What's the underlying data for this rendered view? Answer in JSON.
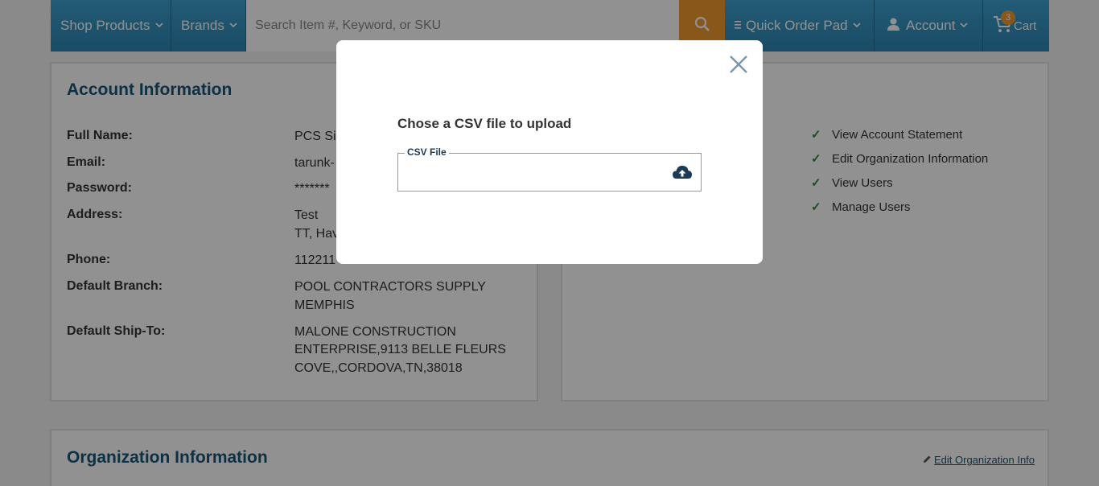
{
  "nav": {
    "shop_products": "Shop Products",
    "brands": "Brands",
    "search_placeholder": "Search Item #, Keyword, or SKU",
    "quick_order_pad": "Quick Order Pad",
    "account": "Account",
    "cart": "Cart",
    "cart_count": "3"
  },
  "account_info": {
    "title": "Account Information",
    "rows": [
      {
        "label": "Full Name:",
        "value": "PCS Sin"
      },
      {
        "label": "Email:",
        "value": "tarunk-"
      },
      {
        "label": "Password:",
        "value": "*******"
      },
      {
        "label": "Address:",
        "value": "Test",
        "value2": "TT, Hav"
      },
      {
        "label": "Phone:",
        "value": "112211"
      },
      {
        "label": "Default Branch:",
        "value": "POOL CONTRACTORS SUPPLY",
        "value2": "MEMPHIS"
      },
      {
        "label": "Default Ship-To:",
        "value": "MALONE CONSTRUCTION",
        "value2": "ENTERPRISE,9113 BELLE FLEURS",
        "value3": "COVE,,CORDOVA,TN,38018"
      }
    ]
  },
  "permissions": [
    "View Account Statement",
    "Edit Organization Information",
    "View Users",
    "Manage Users"
  ],
  "org_info": {
    "title": "Organization Information",
    "edit_link": "Edit Organization Info"
  },
  "modal": {
    "title": "Chose a CSV file to upload",
    "field_label": "CSV File"
  },
  "colors": {
    "nav_bg": "#3fa0cf",
    "accent": "#f39a2e",
    "title_blue": "#1a5577"
  }
}
